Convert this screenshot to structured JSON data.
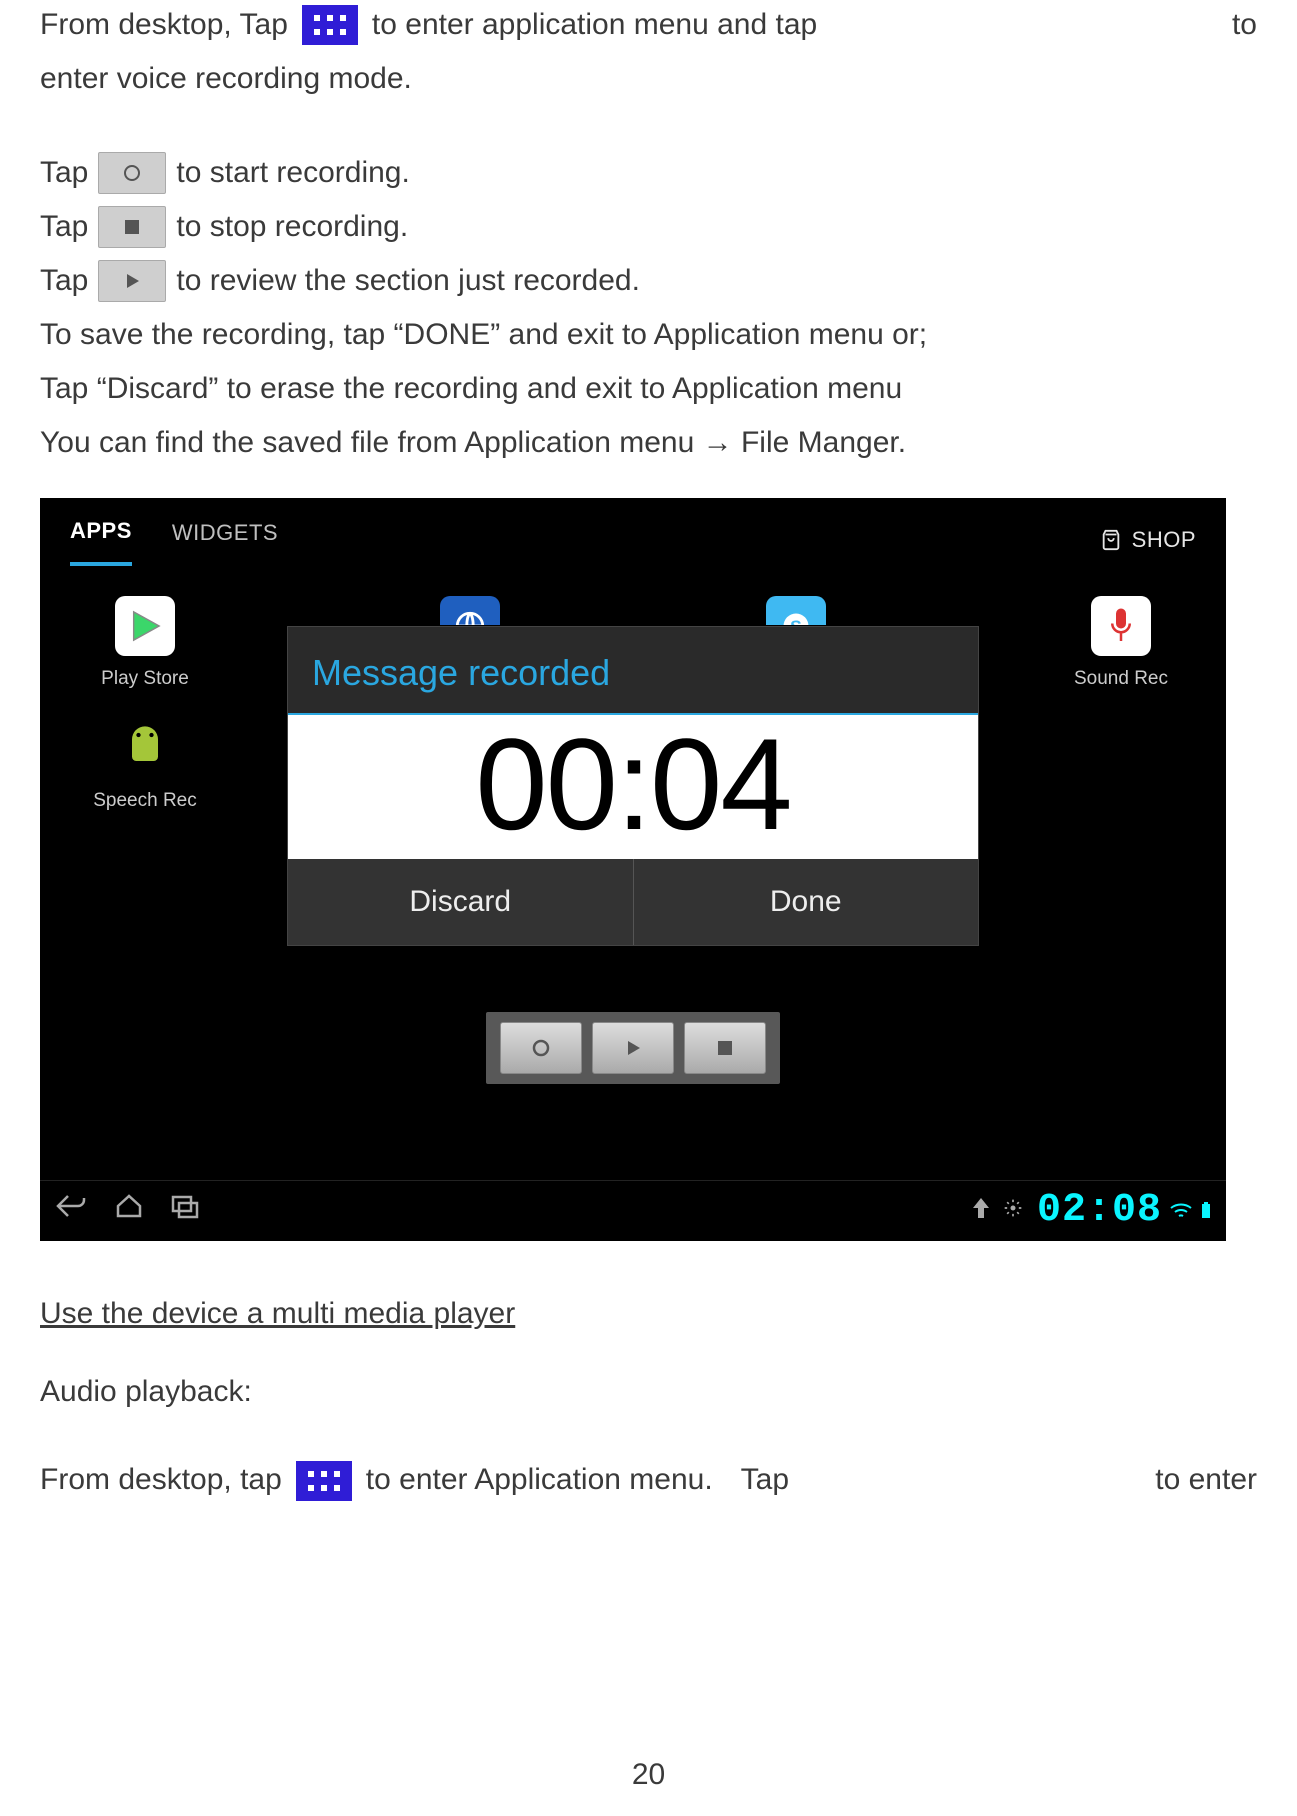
{
  "para1": {
    "a": "From desktop, Tap",
    "b": "to enter application menu and tap",
    "c": "to",
    "d": "enter voice recording mode."
  },
  "rec": {
    "tap": "Tap",
    "start": "to start recording.",
    "stop": "to stop recording.",
    "review": "to review the section just recorded."
  },
  "save_line": "To save the recording, tap “DONE” and exit to Application menu or;",
  "discard_line": "Tap “Discard” to erase the recording and exit to Application menu",
  "find_line": "You can find the saved file from Application menu → File Manger.",
  "android": {
    "tabs": {
      "apps": "APPS",
      "widgets": "WIDGETS",
      "shop": "SHOP"
    },
    "apps": {
      "play": "Play Store",
      "speech": "Speech Rec",
      "sound": "Sound Rec"
    },
    "modal": {
      "title": "Message recorded",
      "timer": "00:04",
      "discard": "Discard",
      "done": "Done"
    },
    "clock": "02:08"
  },
  "heading_media": "Use the device a multi media player",
  "audio_heading": "Audio playback:",
  "para_last": {
    "a": "From desktop, tap",
    "b": "to enter Application menu.",
    "c": "Tap",
    "d": "to enter"
  },
  "page_number": "20"
}
